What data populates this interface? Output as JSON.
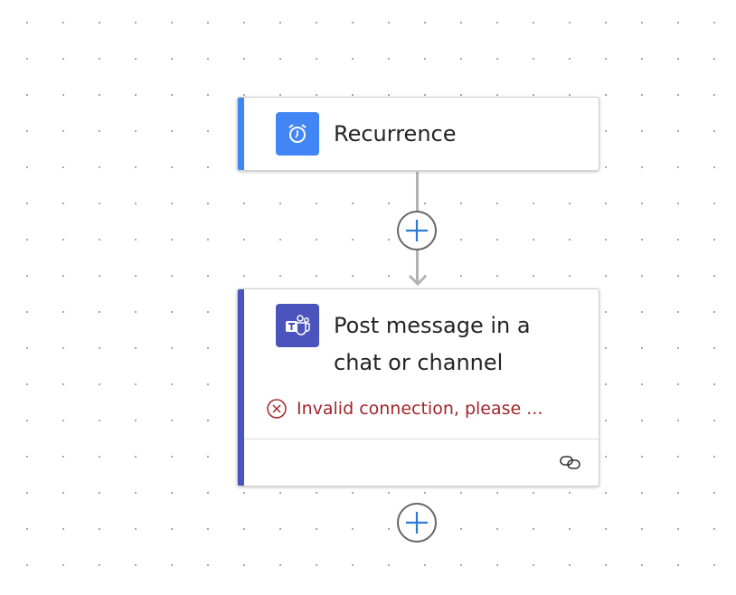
{
  "colors": {
    "recurrence": "#4285f4",
    "teams": "#4b53bc",
    "error": "#a4262c",
    "plus": "#2b7bd6"
  },
  "nodes": [
    {
      "title": "Recurrence",
      "icon": "alarm-clock-icon"
    },
    {
      "title_line1": "Post message in a",
      "title_line2": "chat or channel",
      "icon": "teams-icon",
      "error": "Invalid connection, please ...",
      "footer_icon": "link-icon"
    }
  ]
}
